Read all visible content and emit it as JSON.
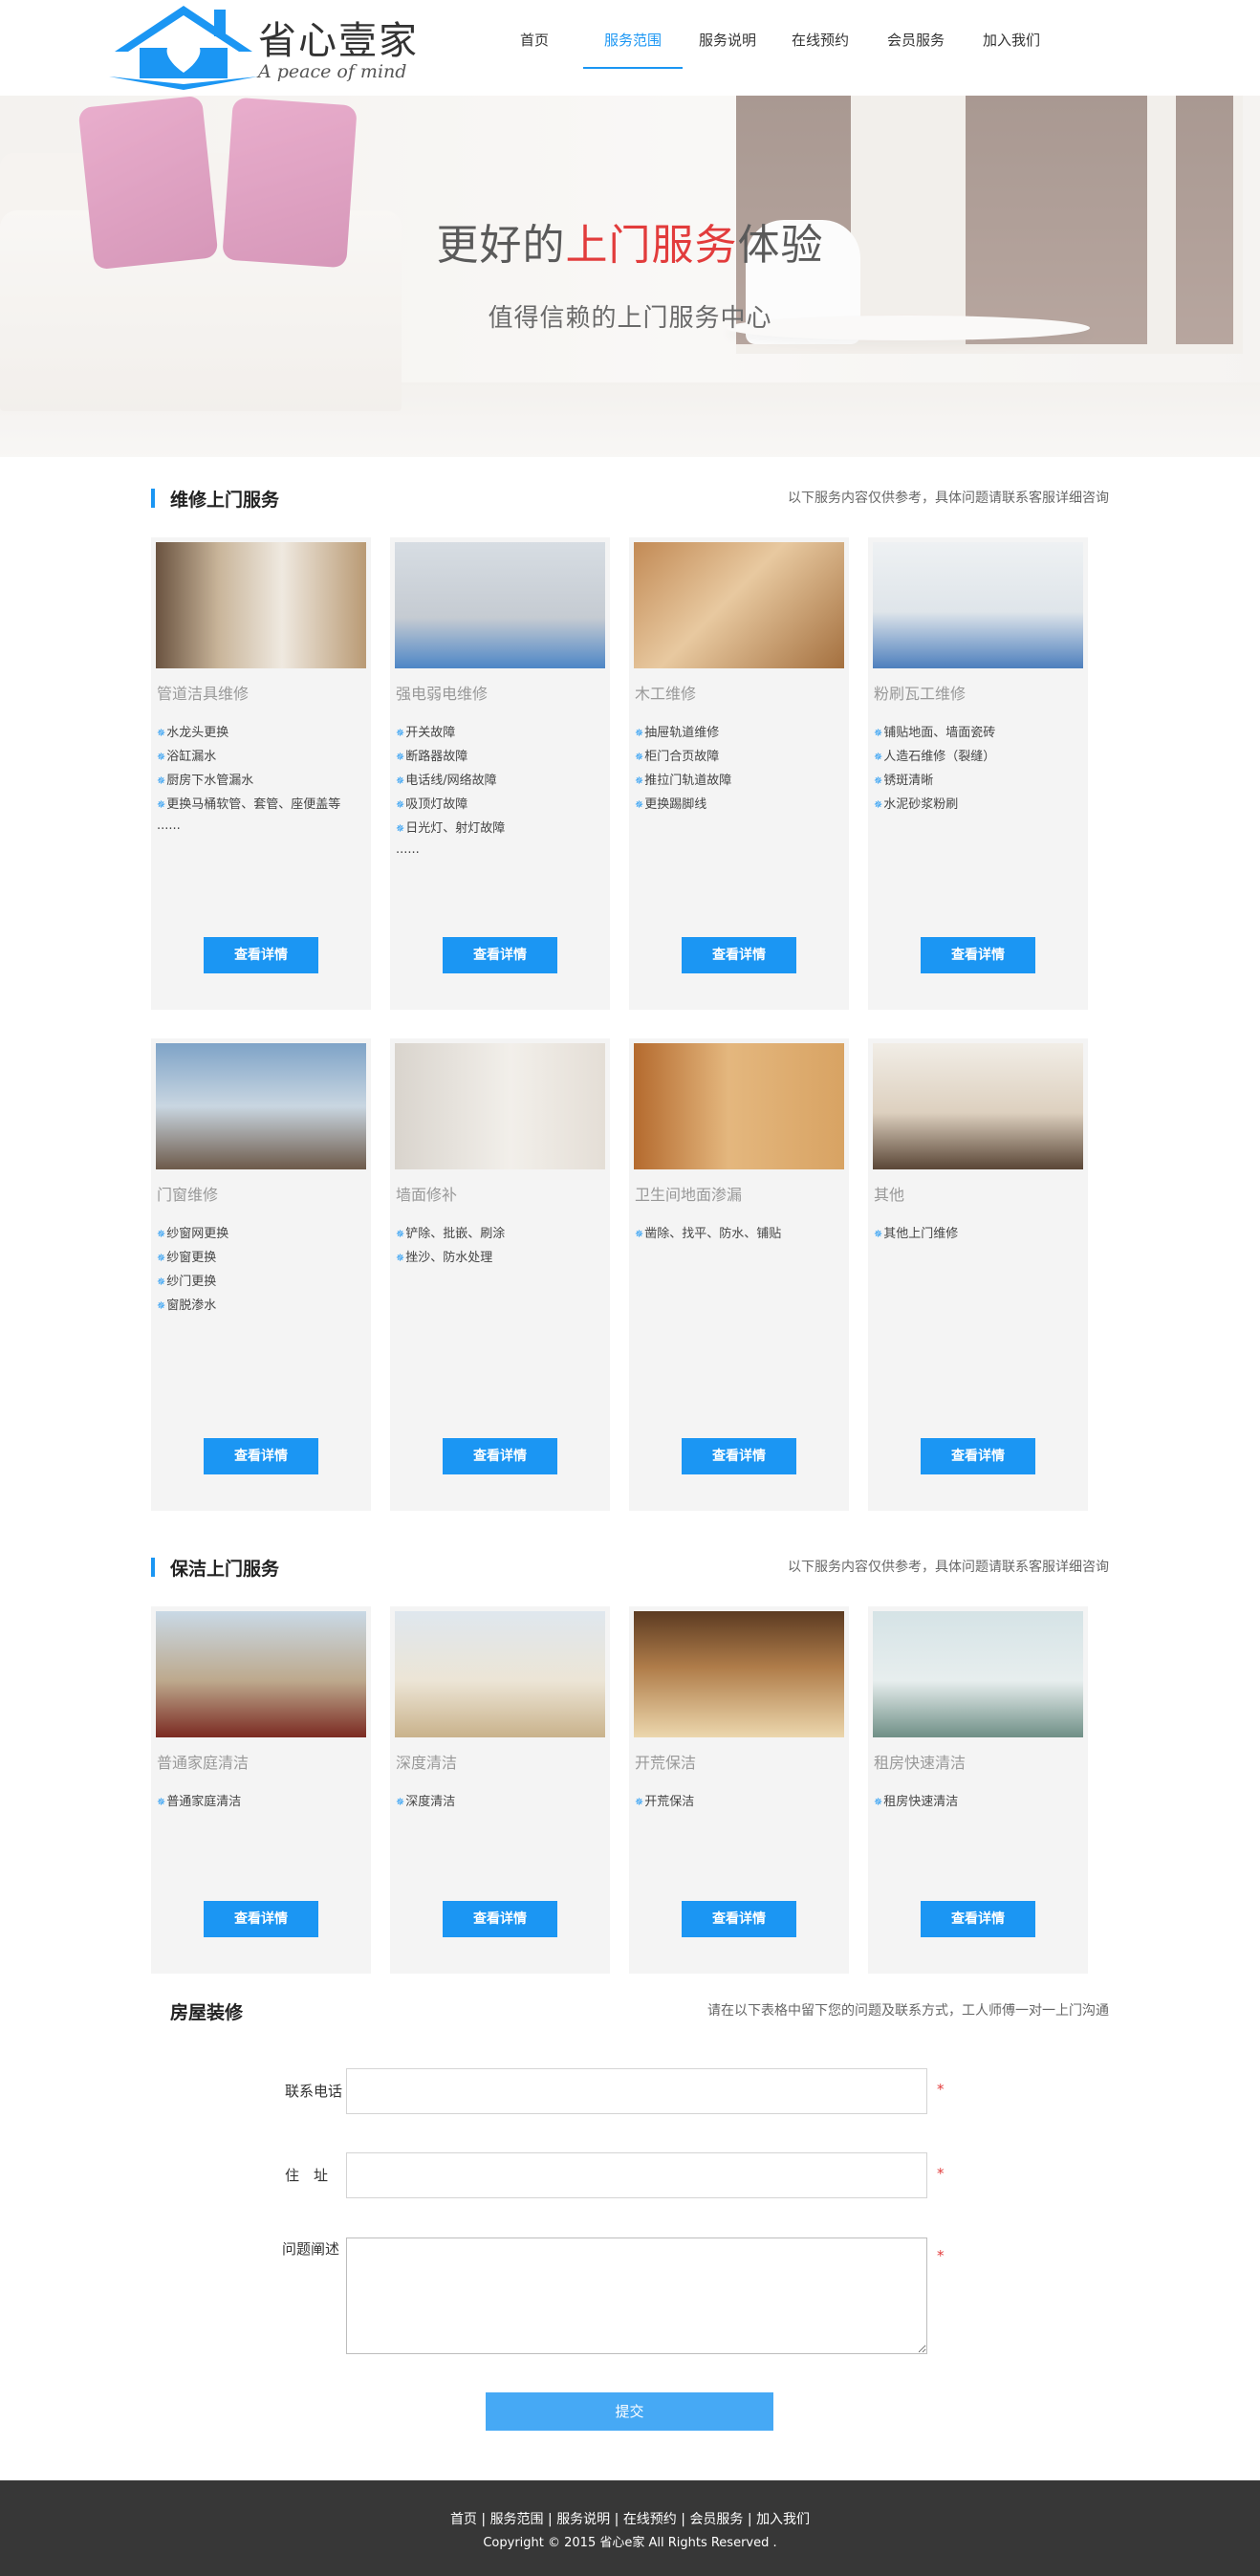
{
  "brand": {
    "name": "省心壹家",
    "slogan": "A peace of mind",
    "accent_color": "#1b96f3"
  },
  "nav": {
    "items": [
      {
        "label": "首页"
      },
      {
        "label": "服务范围"
      },
      {
        "label": "服务说明"
      },
      {
        "label": "在线预约"
      },
      {
        "label": "会员服务"
      },
      {
        "label": "加入我们"
      }
    ],
    "active_index": 1
  },
  "banner": {
    "headline_a": "更好的",
    "headline_b": "上门服务",
    "headline_c": "体验",
    "sub": "值得信赖的上门服务中心"
  },
  "repair": {
    "title": "维修上门服务",
    "note": "以下服务内容仅供参考，具体问题请联系客服详细咨询",
    "cards": [
      {
        "title": "管道洁具维修",
        "items": [
          "水龙头更换",
          "浴缸漏水",
          "厨房下水管漏水",
          "更换马桶软管、套管、座便盖等"
        ],
        "more": "......",
        "button": "查看详情",
        "photo": "bathroom-photo"
      },
      {
        "title": "强电弱电维修",
        "items": [
          "开关故障",
          "断路器故障",
          "电话线/网络故障",
          "吸顶灯故障",
          "日光灯、射灯故障"
        ],
        "more": "......",
        "button": "查看详情",
        "photo": "electrician-photo"
      },
      {
        "title": "木工维修",
        "items": [
          "抽屉轨道维修",
          "柜门合页故障",
          "推拉门轨道故障",
          "更换踢脚线"
        ],
        "more": "",
        "button": "查看详情",
        "photo": "carpentry-photo"
      },
      {
        "title": "粉刷瓦工维修",
        "items": [
          "铺贴地面、墙面瓷砖",
          "人造石维修（裂缝）",
          "锈斑清晰",
          "水泥砂浆粉刷"
        ],
        "more": "",
        "button": "查看详情",
        "photo": "plastering-photo"
      },
      {
        "title": "门窗维修",
        "items": [
          "纱窗网更换",
          "纱窗更换",
          "纱门更换",
          "窗脱渗水"
        ],
        "more": "",
        "button": "查看详情",
        "photo": "window-photo"
      },
      {
        "title": "墙面修补",
        "items": [
          "铲除、批嵌、刷涂",
          "挫沙、防水处理"
        ],
        "more": "",
        "button": "查看详情",
        "photo": "wall-repair-photo"
      },
      {
        "title": "卫生间地面渗漏",
        "items": [
          "凿除、找平、防水、铺贴"
        ],
        "more": "",
        "button": "查看详情",
        "photo": "washroom-photo"
      },
      {
        "title": "其他",
        "items": [
          "其他上门维修"
        ],
        "more": "",
        "button": "查看详情",
        "photo": "living-room-photo"
      }
    ]
  },
  "cleaning": {
    "title": "保洁上门服务",
    "note": "以下服务内容仅供参考，具体问题请联系客服详细咨询",
    "cards": [
      {
        "title": "普通家庭清洁",
        "items": [
          "普通家庭清洁"
        ],
        "button": "查看详情",
        "photo": "home-cleaning-photo"
      },
      {
        "title": "深度清洁",
        "items": [
          "深度清洁"
        ],
        "button": "查看详情",
        "photo": "deep-cleaning-photo"
      },
      {
        "title": "开荒保洁",
        "items": [
          "开荒保洁"
        ],
        "button": "查看详情",
        "photo": "new-home-cleaning-photo"
      },
      {
        "title": "租房快速清洁",
        "items": [
          "租房快速清洁"
        ],
        "button": "查看详情",
        "photo": "rental-cleaning-photo"
      }
    ]
  },
  "renovation": {
    "title": "房屋装修",
    "note": "请在以下表格中留下您的问题及联系方式，工人师傅一对一上门沟通",
    "form": {
      "phone_label": "联系电话",
      "phone_value": "",
      "address_label": "住　址",
      "address_value": "",
      "problem_label": "问题阐述",
      "problem_value": "",
      "required_mark": "*",
      "submit_label": "提交"
    }
  },
  "footer": {
    "links": [
      "首页",
      "服务范围",
      "服务说明",
      "在线预约",
      "会员服务",
      "加入我们"
    ],
    "separator": "|",
    "copyright": "Copyright © 2015 省心e家 All Rights Reserved ."
  }
}
